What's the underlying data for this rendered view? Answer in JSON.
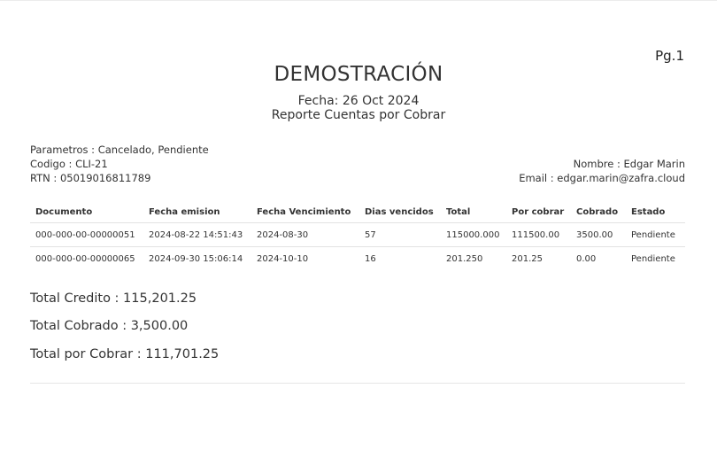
{
  "report": {
    "page": "Pg.1",
    "title": "DEMOSTRACIÓN",
    "date": "Fecha: 26 Oct 2024",
    "subtitle": "Reporte Cuentas por Cobrar"
  },
  "meta": {
    "parametros": "Parametros : Cancelado, Pendiente",
    "codigo": "Codigo : CLI-21",
    "rtn": "RTN : 05019016811789",
    "nombre": "Nombre : Edgar Marin",
    "email": "Email : edgar.marin@zafra.cloud"
  },
  "table": {
    "headers": [
      "Documento",
      "Fecha emision",
      "Fecha Vencimiento",
      "Dias vencidos",
      "Total",
      "Por cobrar",
      "Cobrado",
      "Estado"
    ],
    "rows": [
      [
        "000-000-00-00000051",
        "2024-08-22 14:51:43",
        "2024-08-30",
        "57",
        "115000.000",
        "111500.00",
        "3500.00",
        "Pendiente"
      ],
      [
        "000-000-00-00000065",
        "2024-09-30 15:06:14",
        "2024-10-10",
        "16",
        "201.250",
        "201.25",
        "0.00",
        "Pendiente"
      ]
    ]
  },
  "totals": {
    "credito": "Total Credito : 115,201.25",
    "cobrado": "Total Cobrado : 3,500.00",
    "por_cobrar": "Total por Cobrar : 111,701.25"
  }
}
